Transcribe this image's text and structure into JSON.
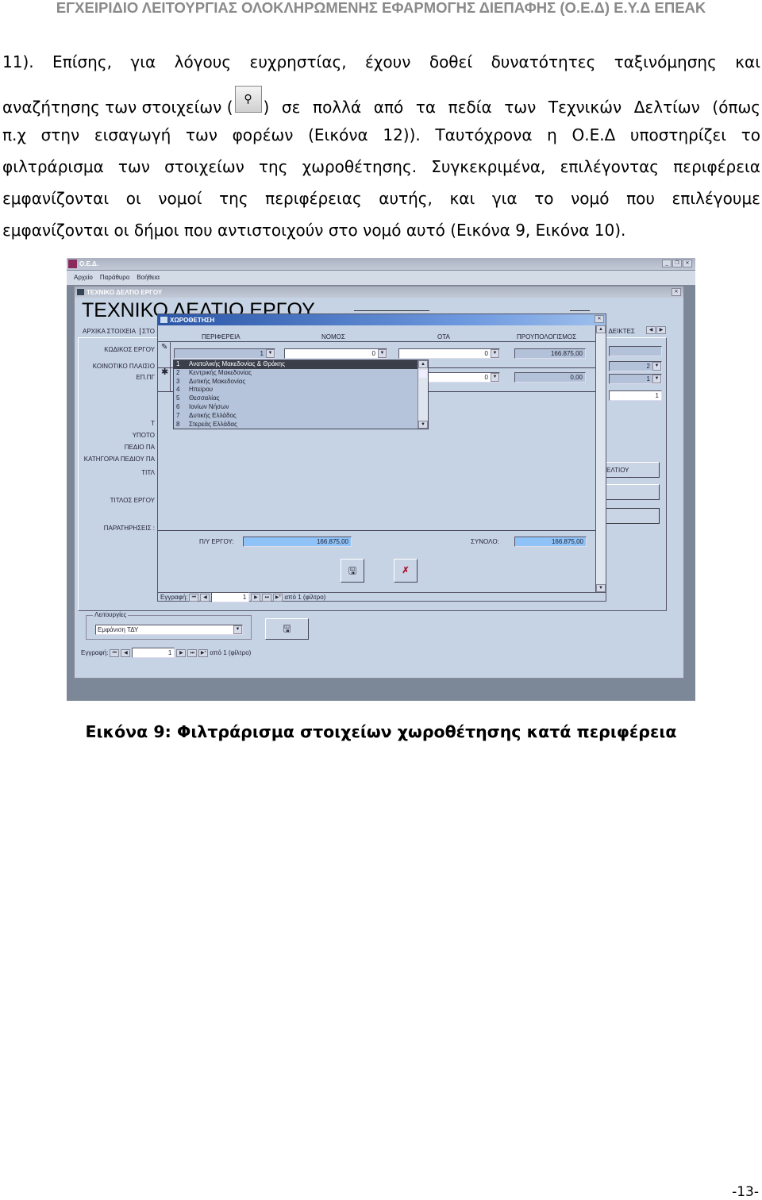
{
  "header": "ΕΓΧΕΙΡΙΔΙΟ ΛΕΙΤΟΥΡΓΙΑΣ ΟΛΟΚΛΗΡΩΜΕΝΗΣ ΕΦΑΡΜΟΓΗΣ ΔΙΕΠΑΦΗΣ (Ο.Ε.Δ) Ε.Υ.Δ ΕΠΕΑΚ",
  "paragraph": {
    "line1": "11). Επίσης, για λόγους ευχρηστίας, έχουν δοθεί δυνατότητες ταξινόμησης και",
    "line2_before": "αναζήτησης των στοιχείων (",
    "line2_icon": "binoculars-icon",
    "line2_after": ") σε πολλά από τα πεδία των Τεχνικών Δελτίων (όπως",
    "line3": "π.χ στην εισαγωγή των φορέων (Εικόνα 12)). Ταυτόχρονα η Ο.Ε.Δ υποστηρίζει το",
    "line4": "φιλτράρισμα των στοιχείων της χωροθέτησης. Συγκεκριμένα, επιλέγοντας περιφέρεια",
    "line5": "εμφανίζονται οι νομοί της περιφέρειας αυτής, και για το νομό που επιλέγουμε",
    "line6": "εμφανίζονται οι δήμοι που αντιστοιχούν στο νομό αυτό (Εικόνα 9, Εικόνα 10)."
  },
  "screenshot": {
    "app_title": "O.E.Δ.",
    "menu": [
      "Αρχείο",
      "Παράθυρο",
      "Βοήθεια"
    ],
    "form_title_bar": "ΤΕΧΝΙΚΟ ΔΕΛΤΙΟ ΕΡΓΟΥ",
    "form_heading": "ΤΕΧΝΙΚΟ ΔΕΛΤΙΟ ΕΡΓΟΥ",
    "tabs": [
      "ΑΡΧΙΚΑ ΣΤΟΙΧΕΙΑ",
      "ΣΤΟ",
      ") ΔΕΙΚΤΕΣ"
    ],
    "labels": [
      "ΚΩΔΙΚΟΣ ΕΡΓΟΥ",
      "ΚΟΙΝΟΤΙΚΟ ΠΛΑΙΣΙΟ",
      "ΕΠ.ΠΓ",
      "Τ",
      "ΥΠΟΤΟ",
      "ΠΕΔΙΟ ΠΑ",
      "ΚΑΤΗΓΟΡΙΑ ΠΕΔΙΟΥ ΠΑ",
      "ΤΙΤΛ",
      "ΤΙΤΛΟΣ ΕΡΓΟΥ",
      "ΠΑΡΑΤΗΡΗΣΕΙΣ :"
    ],
    "right_values": [
      "",
      "2",
      "1",
      "1"
    ],
    "right_buttons": [
      "ΕΛΤΙΟΥ",
      "",
      ""
    ],
    "functions_label": "Λειτουργίες",
    "functions_value": "Εμφάνιση ΤΔΥ",
    "nav": {
      "label": "Εγγραφή:",
      "value": "1",
      "of": "από 1 (φίλτρο)"
    },
    "dialog": {
      "title": "ΧΩΡΟΘΕΤΗΣΗ",
      "columns": [
        "ΠΕΡΙΦΕΡΕΙΑ",
        "ΝΟΜΟΣ",
        "ΟΤΑ",
        "ΠΡΟΥΠΟΛΟΓΙΣΜΟΣ"
      ],
      "row1": {
        "perifereia": "1",
        "nomos": "0",
        "ota": "0",
        "budget": "166.875,00"
      },
      "row2": {
        "ota": "0",
        "budget": "0,00"
      },
      "dropdown": [
        {
          "id": "1",
          "name": "Ανατολικής Μακεδονίας & Θράκης"
        },
        {
          "id": "2",
          "name": "Κεντρικής Μακεδονίας"
        },
        {
          "id": "3",
          "name": "Δυτικής Μακεδονίας"
        },
        {
          "id": "4",
          "name": "Ηπείρου"
        },
        {
          "id": "5",
          "name": "Θεσσαλίας"
        },
        {
          "id": "6",
          "name": "Ιονίων Νήσων"
        },
        {
          "id": "7",
          "name": "Δυτικής Ελλάδος"
        },
        {
          "id": "8",
          "name": "Στερεάς Ελλάδας"
        }
      ],
      "py_label": "Π/Υ ΕΡΓΟΥ:",
      "py_value": "166.875,00",
      "total_label": "ΣΥΝΟΛΟ:",
      "total_value": "166.875,00",
      "nav": {
        "label": "Εγγραφή:",
        "value": "1",
        "of": "από 1 (φίλτρο)"
      }
    },
    "colors": {
      "background": "#c6d3e5",
      "title_bar": "#2f5ea8",
      "highlight": "#3a3f4a",
      "sum_field": "#8fc3f7"
    }
  },
  "caption": "Εικόνα 9: Φιλτράρισμα στοιχείων χωροθέτησης κατά περιφέρεια",
  "page_number": "-13-"
}
